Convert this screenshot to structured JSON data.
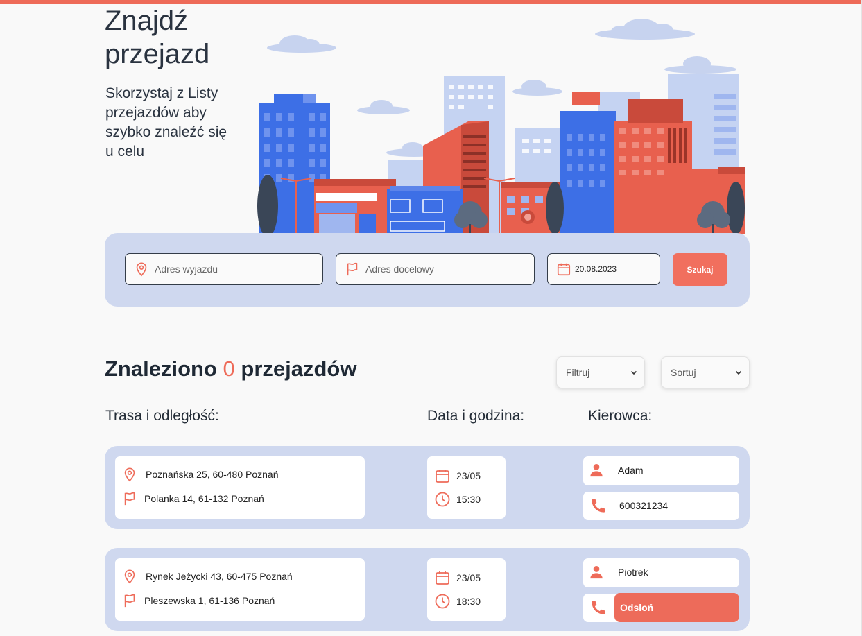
{
  "hero": {
    "title_line1": "Znajdź",
    "title_line2": "przejazd",
    "subtitle": "Skorzystaj z Listy przejazdów aby szybko znaleźć się u celu"
  },
  "search": {
    "from_placeholder": "Adres wyjazdu",
    "to_placeholder": "Adres docelowy",
    "date_value": "20.08.2023",
    "button_label": "Szukaj"
  },
  "results": {
    "prefix": "Znaleziono",
    "count": "0",
    "suffix": "przejazdów",
    "filter_label": "Filtruj",
    "sort_label": "Sortuj"
  },
  "columns": {
    "route": "Trasa i odległość:",
    "datetime": "Data i godzina:",
    "driver": "Kierowca:"
  },
  "rides": [
    {
      "from": "Poznańska 25, 60-480 Poznań",
      "to": "Polanka 14, 61-132 Poznań",
      "date": "23/05",
      "time": "15:30",
      "driver": "Adam",
      "phone": "600321234"
    },
    {
      "from": "Rynek Jeżycki 43, 60-475 Poznań",
      "to": "Pleszewska 1, 61-136 Poznań",
      "date": "23/05",
      "time": "18:30",
      "driver": "Piotrek",
      "reveal_label": "Odsłoń"
    }
  ],
  "colors": {
    "accent": "#ee6b59",
    "panel": "#cfd8ef",
    "blue": "#3d6fe6",
    "dark_text": "#222b36"
  }
}
